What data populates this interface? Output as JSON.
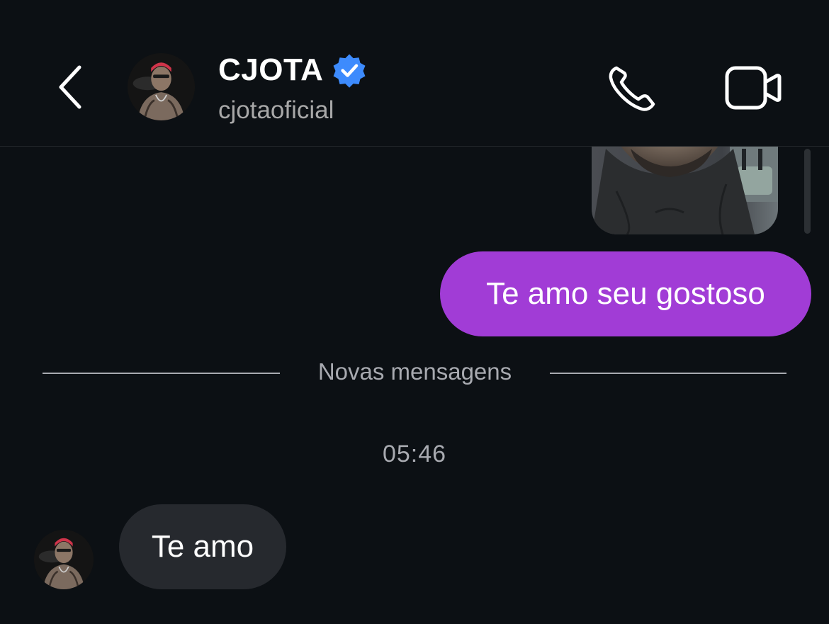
{
  "header": {
    "contact_name": "CJOTA",
    "contact_handle": "cjotaoficial",
    "verified": true
  },
  "icons": {
    "back": "chevron-left-icon",
    "verified": "verified-badge-icon",
    "call": "phone-icon",
    "video": "video-camera-icon"
  },
  "thread": {
    "outgoing_message": "Te amo seu gostoso",
    "divider_label": "Novas mensagens",
    "timestamp": "05:46",
    "incoming_message": "Te amo"
  },
  "colors": {
    "background": "#0c1014",
    "outgoing_bubble": "#a13cd6",
    "incoming_bubble": "#26292e",
    "verified_blue": "#3d8bfd",
    "muted_text": "#a8aab0"
  }
}
